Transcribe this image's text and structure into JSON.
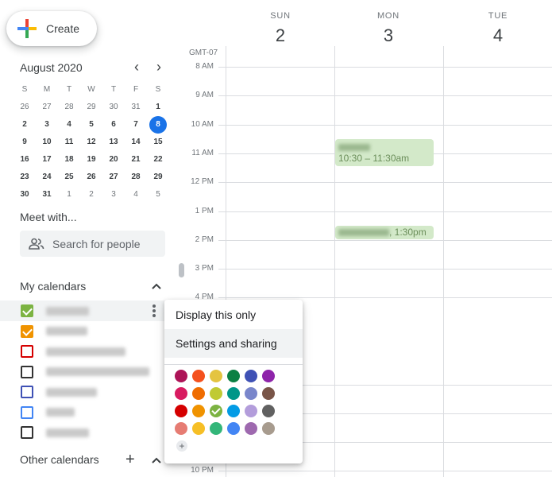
{
  "create": {
    "label": "Create"
  },
  "mini_calendar": {
    "title": "August 2020",
    "prev": "‹",
    "next": "›",
    "weekdays": [
      "S",
      "M",
      "T",
      "W",
      "T",
      "F",
      "S"
    ],
    "weeks": [
      [
        "26",
        "27",
        "28",
        "29",
        "30",
        "31",
        "1"
      ],
      [
        "2",
        "3",
        "4",
        "5",
        "6",
        "7",
        "8"
      ],
      [
        "9",
        "10",
        "11",
        "12",
        "13",
        "14",
        "15"
      ],
      [
        "16",
        "17",
        "18",
        "19",
        "20",
        "21",
        "22"
      ],
      [
        "23",
        "24",
        "25",
        "26",
        "27",
        "28",
        "29"
      ],
      [
        "30",
        "31",
        "1",
        "2",
        "3",
        "4",
        "5"
      ]
    ],
    "today": "8"
  },
  "meet": {
    "title": "Meet with...",
    "search_placeholder": "Search for people"
  },
  "my_calendars": {
    "title": "My calendars",
    "chevron": "⌃",
    "items": [
      {
        "color": "#7cb342",
        "checked": true
      },
      {
        "color": "#f09300",
        "checked": true
      },
      {
        "color": "#d50000",
        "checked": false
      },
      {
        "color": "#333333",
        "checked": false
      },
      {
        "color": "#3f51b5",
        "checked": false
      },
      {
        "color": "#4285f4",
        "checked": false
      },
      {
        "color": "#333333",
        "checked": false
      }
    ]
  },
  "other_calendars": {
    "title": "Other calendars",
    "add": "+",
    "chevron": "⌃"
  },
  "week": {
    "timezone": "GMT-07",
    "days": [
      {
        "name": "SUN",
        "num": "2"
      },
      {
        "name": "MON",
        "num": "3"
      },
      {
        "name": "TUE",
        "num": "4"
      }
    ],
    "hours": [
      "8 AM",
      "9 AM",
      "10 AM",
      "11 AM",
      "12 PM",
      "1 PM",
      "2 PM",
      "3 PM",
      "4 PM",
      "10 PM"
    ]
  },
  "events": [
    {
      "time": "10:30 – 11:30am",
      "color": "#d3e9c9"
    },
    {
      "time": ", 1:30pm",
      "color": "#d3e9c9"
    }
  ],
  "menu": {
    "display_only": "Display this only",
    "settings": "Settings and sharing",
    "add_color": "+",
    "colors": [
      [
        "#ad1457",
        "#f4511e",
        "#e4c441",
        "#0b8043",
        "#3f51b5",
        "#8e24aa"
      ],
      [
        "#d81b60",
        "#ef6c00",
        "#c0ca33",
        "#009688",
        "#7986cb",
        "#795548"
      ],
      [
        "#d50000",
        "#f09300",
        "#7cb342",
        "#039be5",
        "#b39ddb",
        "#616161"
      ],
      [
        "#e67c73",
        "#f6bf26",
        "#33b679",
        "#4285f4",
        "#9e69af",
        "#a79b8e"
      ]
    ],
    "selected_color": "#7cb342"
  }
}
